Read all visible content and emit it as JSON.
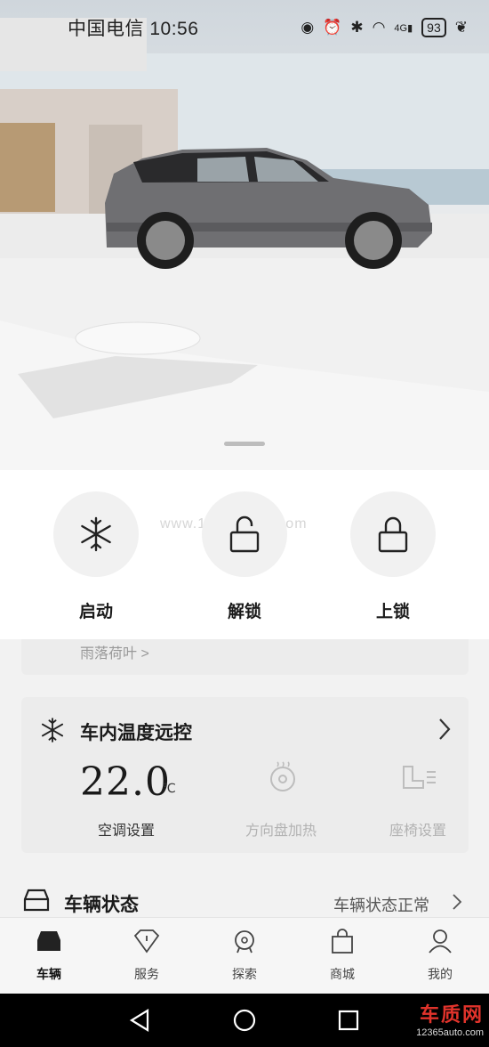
{
  "status_bar": {
    "carrier_time": "中国电信 10:56",
    "battery": "93",
    "network": "4G"
  },
  "controls": {
    "start_label": "启动",
    "unlock_label": "解锁",
    "lock_label": "上锁"
  },
  "watermark": "www.12365auto.com",
  "partial_card": {
    "text": "雨落荷叶 >"
  },
  "climate_card": {
    "title": "车内温度远控",
    "temperature": "22.0",
    "unit": "℃",
    "ac_label": "空调设置",
    "wheel_heat_label": "方向盘加热",
    "seat_label": "座椅设置"
  },
  "vehicle_status": {
    "title": "车辆状态",
    "value": "车辆状态正常"
  },
  "bottom_nav": {
    "items": [
      {
        "label": "车辆",
        "icon": "car-icon",
        "active": true
      },
      {
        "label": "服务",
        "icon": "diamond-icon",
        "active": false
      },
      {
        "label": "探索",
        "icon": "badge-icon",
        "active": false
      },
      {
        "label": "商城",
        "icon": "shopping-bag-icon",
        "active": false
      },
      {
        "label": "我的",
        "icon": "person-icon",
        "active": false
      }
    ]
  },
  "brand_watermark": {
    "main": "车质网",
    "sub": "12365auto.com"
  }
}
